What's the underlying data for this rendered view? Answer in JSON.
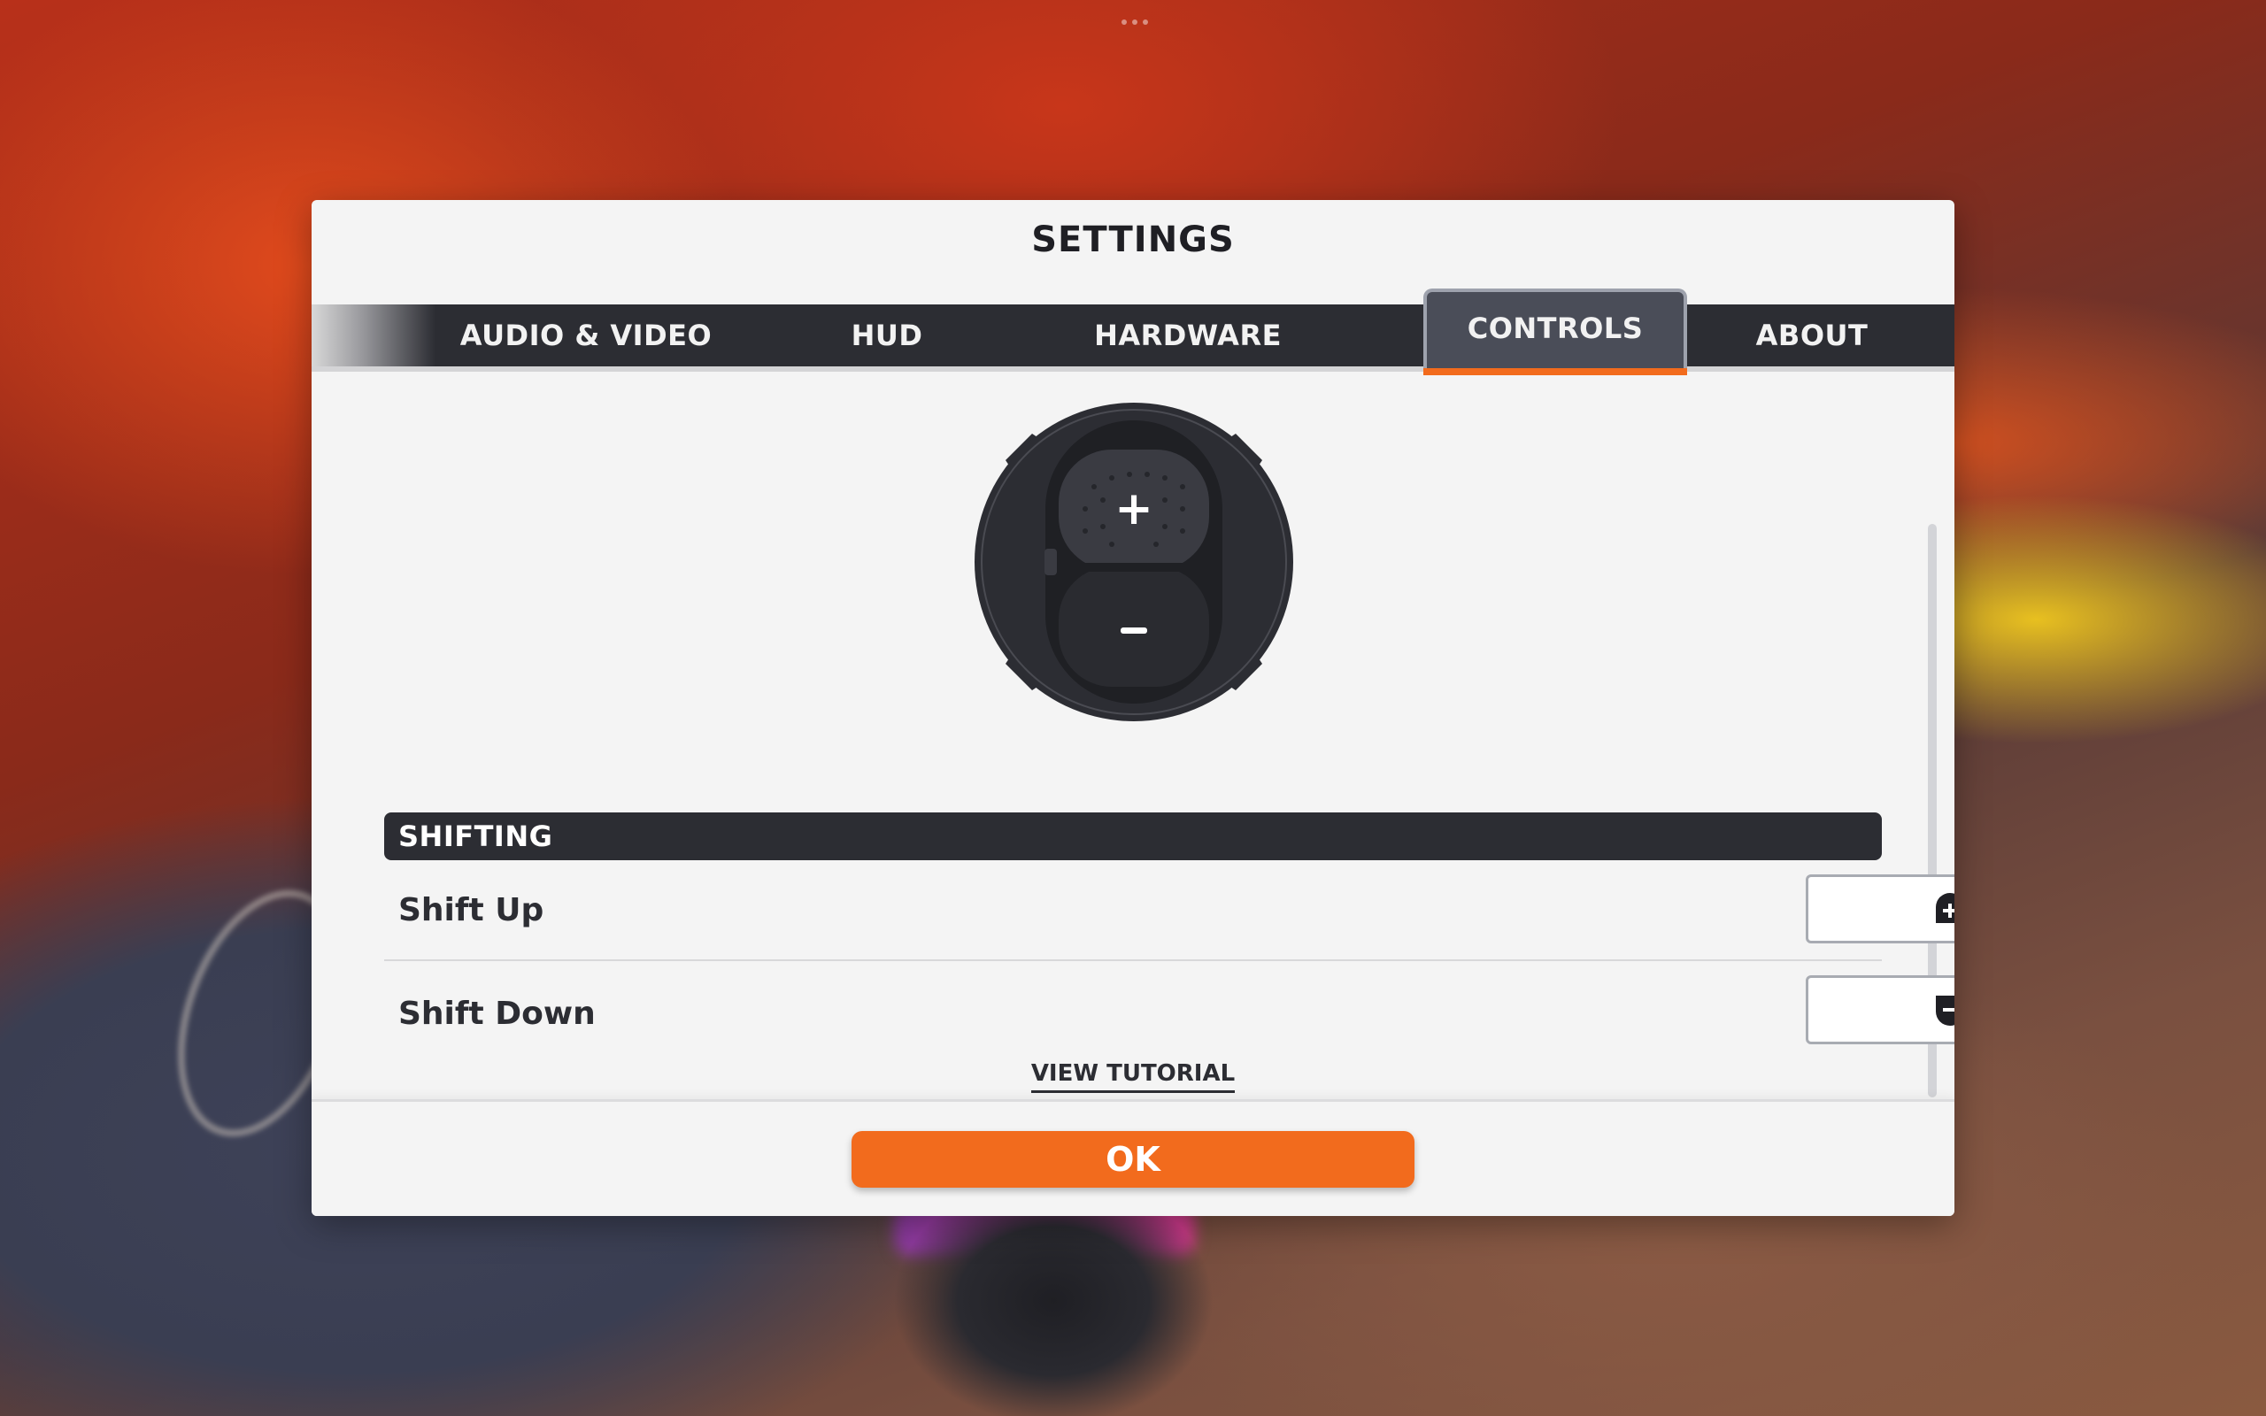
{
  "dialog": {
    "title": "SETTINGS"
  },
  "tabs": [
    {
      "label": "AUDIO & VIDEO",
      "active": false
    },
    {
      "label": "HUD",
      "active": false
    },
    {
      "label": "HARDWARE",
      "active": false
    },
    {
      "label": "CONTROLS",
      "active": true
    },
    {
      "label": "ABOUT",
      "active": false
    }
  ],
  "controller": {
    "up_symbol": "+",
    "down_symbol": "−",
    "icon": "controller-icon"
  },
  "section": {
    "title": "SHIFTING",
    "rows": [
      {
        "label": "Shift Up",
        "binding_icon": "shift-up-icon",
        "binding_symbol": "+"
      },
      {
        "label": "Shift Down",
        "binding_icon": "shift-down-icon",
        "binding_symbol": "−"
      }
    ]
  },
  "tutorial_link": "VIEW TUTORIAL",
  "footer": {
    "ok_label": "OK"
  },
  "colors": {
    "accent": "#f26b1d",
    "tab_bar": "#2c2d33",
    "active_tab": "#4a4d58",
    "dialog_bg": "#f4f4f4"
  }
}
